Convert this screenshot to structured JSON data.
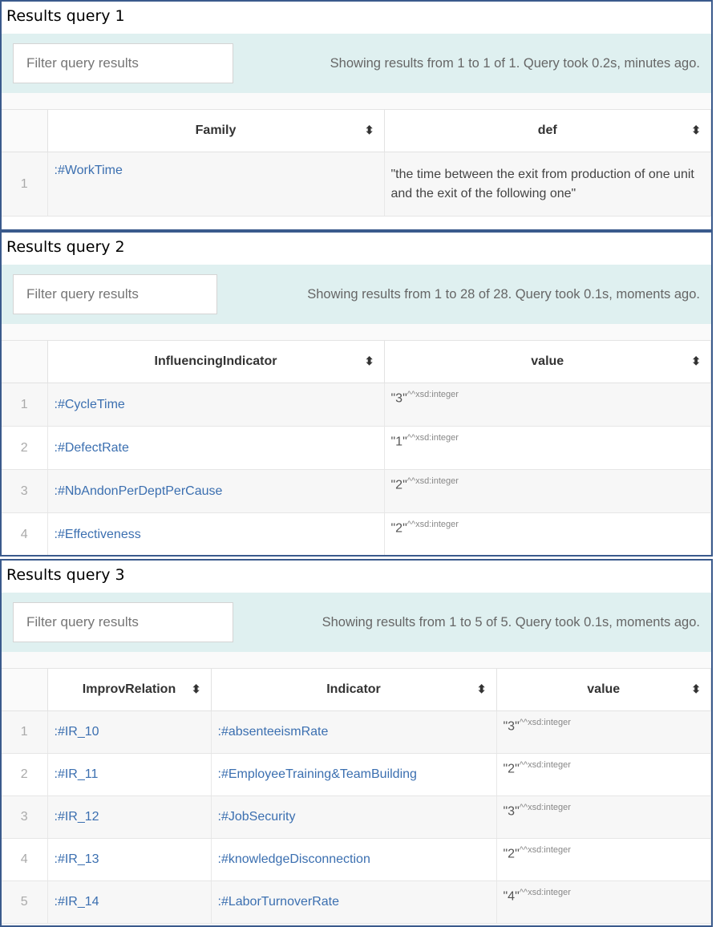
{
  "queries": [
    {
      "title": "Results query 1",
      "filter_placeholder": "Filter query results",
      "status": "Showing results from 1 to 1 of 1. Query took 0.2s, minutes ago.",
      "columns": [
        "Family",
        "def"
      ],
      "rows": [
        {
          "index": "1",
          "family": ":#WorkTime",
          "def": "\"the time between the exit from production of one unit and the exit of the following one\""
        }
      ]
    },
    {
      "title": "Results query 2",
      "filter_placeholder": "Filter query results",
      "status": "Showing results from 1 to 28 of 28. Query took 0.1s, moments ago.",
      "columns": [
        "InfluencingIndicator",
        "value"
      ],
      "rows": [
        {
          "index": "1",
          "indicator": ":#CycleTime",
          "value_open": "\"3\"",
          "value_type": "^^xsd:integer"
        },
        {
          "index": "2",
          "indicator": ":#DefectRate",
          "value_open": "\"1\"",
          "value_type": "^^xsd:integer"
        },
        {
          "index": "3",
          "indicator": ":#NbAndonPerDeptPerCause",
          "value_open": "\"2\"",
          "value_type": "^^xsd:integer"
        },
        {
          "index": "4",
          "indicator": ":#Effectiveness",
          "value_open": "\"2\"",
          "value_type": "^^xsd:integer"
        }
      ]
    },
    {
      "title": "Results query 3",
      "filter_placeholder": "Filter query results",
      "status": "Showing results from 1 to 5 of 5. Query took 0.1s, moments ago.",
      "columns": [
        "ImprovRelation",
        "Indicator",
        "value"
      ],
      "rows": [
        {
          "index": "1",
          "relation": ":#IR_10",
          "indicator": ":#absenteeismRate",
          "value_open": "\"3\"",
          "value_type": "^^xsd:integer"
        },
        {
          "index": "2",
          "relation": ":#IR_11",
          "indicator": ":#EmployeeTraining&TeamBuilding",
          "value_open": "\"2\"",
          "value_type": "^^xsd:integer"
        },
        {
          "index": "3",
          "relation": ":#IR_12",
          "indicator": ":#JobSecurity",
          "value_open": "\"3\"",
          "value_type": "^^xsd:integer"
        },
        {
          "index": "4",
          "relation": ":#IR_13",
          "indicator": ":#knowledgeDisconnection",
          "value_open": "\"2\"",
          "value_type": "^^xsd:integer"
        },
        {
          "index": "5",
          "relation": ":#IR_14",
          "indicator": ":#LaborTurnoverRate",
          "value_open": "\"4\"",
          "value_type": "^^xsd:integer"
        }
      ]
    }
  ],
  "icons": {
    "sort": "sort-arrows-icon"
  },
  "colors": {
    "border": "#3a5a8c",
    "toolbar": "#dff0f0",
    "link": "#3b6fb0"
  }
}
